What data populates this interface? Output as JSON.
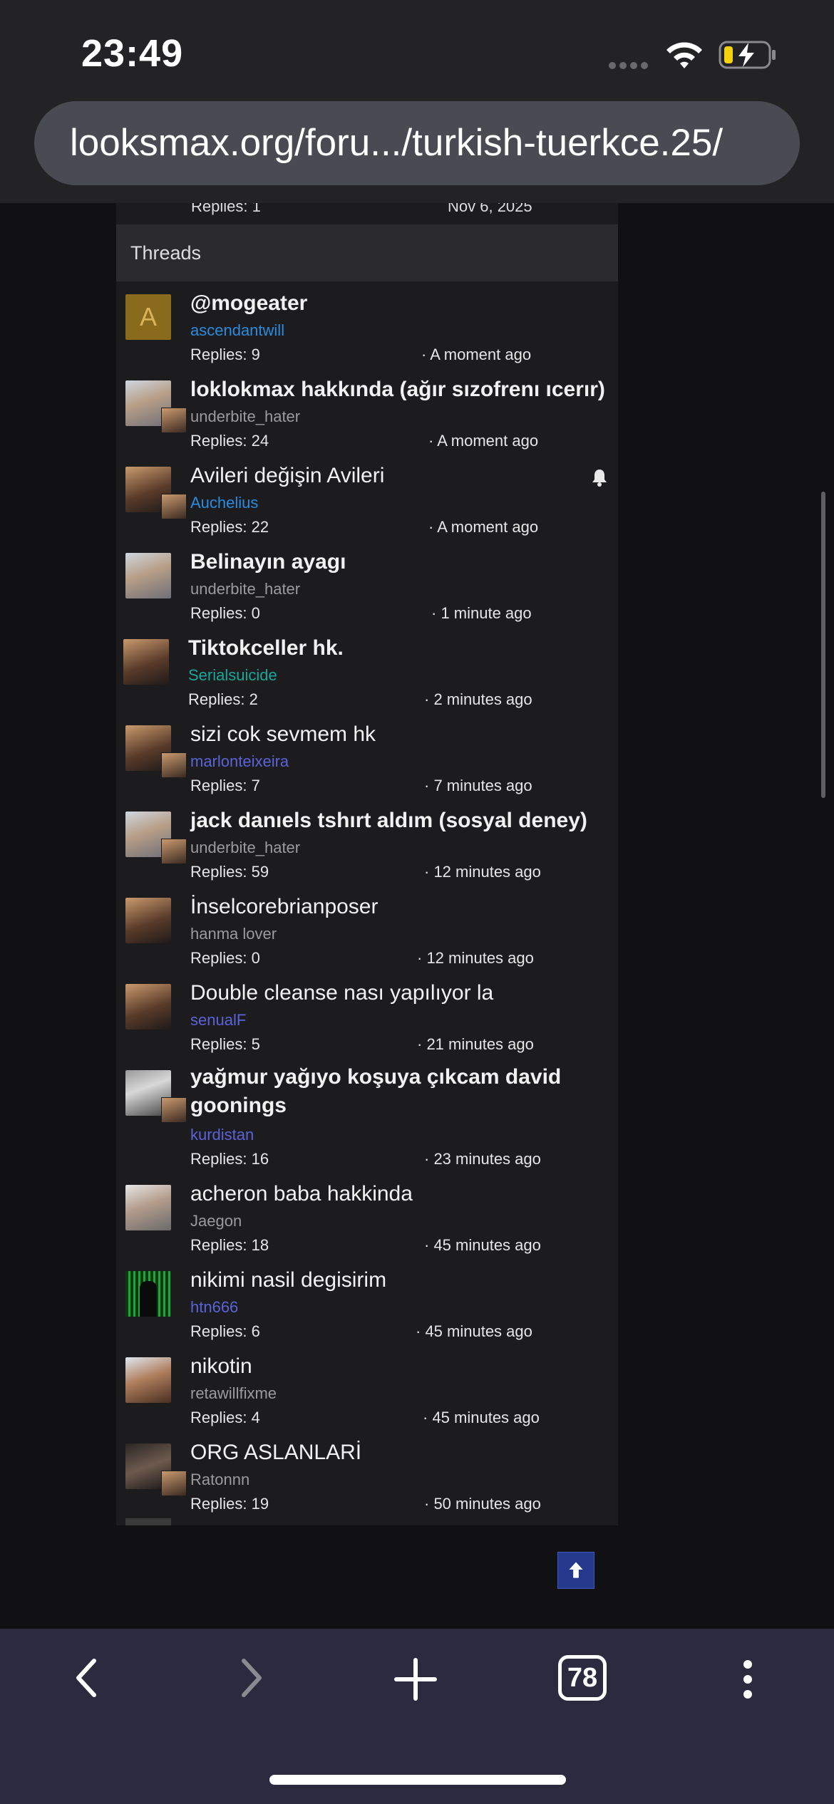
{
  "status_bar": {
    "time": "23:49"
  },
  "browser": {
    "url": "looksmax.org/foru.../turkish-tuerkce.25/",
    "tab_count": "78"
  },
  "previous_section": {
    "replies": "Replies: 1",
    "date": "Nov 6, 2025"
  },
  "threads_section": {
    "header": "Threads",
    "items": [
      {
        "title": "@mogeater",
        "author": "ascendantwill",
        "replies": "Replies: 9",
        "time": "· A moment ago"
      },
      {
        "title": "loklokmax hakkında (ağır sızofrenı ıcerır)",
        "author": "underbite_hater",
        "replies": "Replies: 24",
        "time": "· A moment ago"
      },
      {
        "title": "Avileri değişin Avileri",
        "author": "Auchelius",
        "replies": "Replies: 22",
        "time": "· A moment ago"
      },
      {
        "title": "Belinayın ayagı",
        "author": "underbite_hater",
        "replies": "Replies: 0",
        "time": "· 1 minute ago"
      },
      {
        "title": "Tiktokceller hk.",
        "author": "Serialsuicide",
        "replies": "Replies: 2",
        "time": "· 2 minutes ago"
      },
      {
        "title": "sizi cok sevmem hk",
        "author": "marlonteixeira",
        "replies": "Replies: 7",
        "time": "· 7 minutes ago"
      },
      {
        "title": "jack danıels tshırt aldım (sosyal deney)",
        "author": "underbite_hater",
        "replies": "Replies: 59",
        "time": "· 12 minutes ago"
      },
      {
        "title": "İnselcorebrianposer",
        "author": "hanma lover",
        "replies": "Replies: 0",
        "time": "· 12 minutes ago"
      },
      {
        "title": "Double cleanse nası yapılıyor la",
        "author": "senualF",
        "replies": "Replies: 5",
        "time": "· 21 minutes ago"
      },
      {
        "title": "yağmur yağıyo koşuya çıkcam david goonings",
        "author": "kurdistan",
        "replies": "Replies: 16",
        "time": "· 23 minutes ago"
      },
      {
        "title": "acheron baba hakkinda",
        "author": "Jaegon",
        "replies": "Replies: 18",
        "time": "· 45 minutes ago"
      },
      {
        "title": "nikimi nasil degisirim",
        "author": "htn666",
        "replies": "Replies: 6",
        "time": "· 45 minutes ago"
      },
      {
        "title": "nikotin",
        "author": "retawillfixme",
        "replies": "Replies: 4",
        "time": "· 45 minutes ago"
      },
      {
        "title": "ORG ASLANLARİ",
        "author": "Ratonnn",
        "replies": "Replies: 19",
        "time": "· 50 minutes ago"
      }
    ]
  },
  "avatar_letter": "A",
  "icons": {
    "back": "chevron-left-icon",
    "forward": "chevron-right-icon",
    "new_tab": "plus-icon",
    "menu": "more-vertical-icon",
    "watched": "bell-icon",
    "to_top": "arrow-up-icon"
  },
  "colors": {
    "page_bg": "#111114",
    "content_bg": "#1c1c1e",
    "link_blue": "#2a8be0",
    "link_teal": "#18a79a",
    "link_indigo": "#5b63d8",
    "toolbar_bg": "#2c2a3e"
  }
}
